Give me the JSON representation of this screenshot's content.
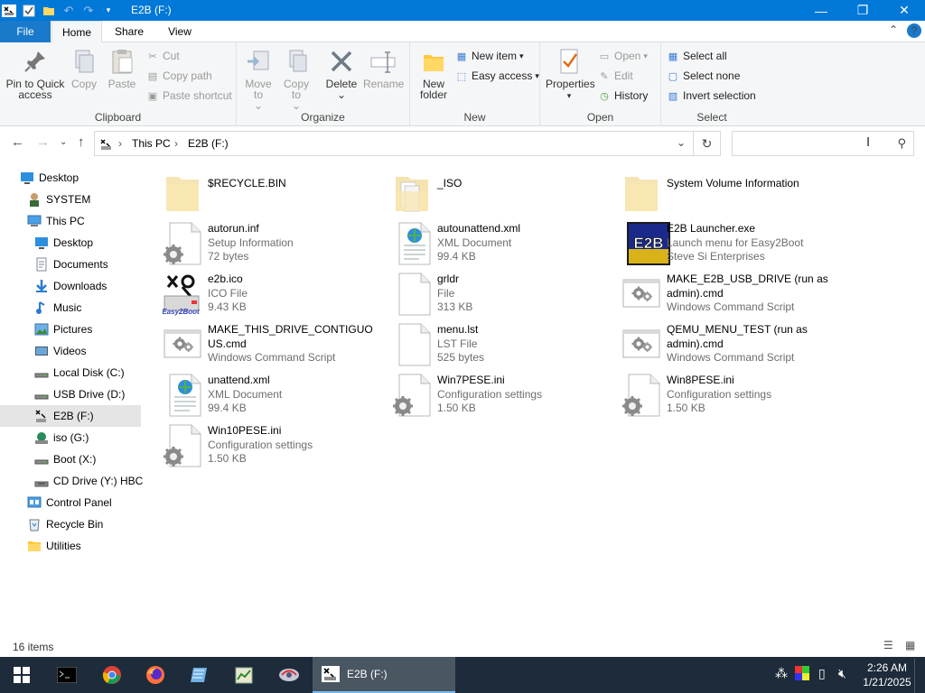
{
  "window": {
    "title": "E2B (F:)",
    "minimize_glyph": "—",
    "maximize_glyph": "❐",
    "close_glyph": "✕"
  },
  "ribbon_tabs": {
    "file": "File",
    "home": "Home",
    "share": "Share",
    "view": "View",
    "help": "?"
  },
  "clipboard": {
    "label": "Clipboard",
    "pin": "Pin to Quick access",
    "copy": "Copy",
    "paste": "Paste",
    "cut": "Cut",
    "copy_path": "Copy path",
    "paste_shortcut": "Paste shortcut"
  },
  "organize": {
    "label": "Organize",
    "move_to": "Move to",
    "copy_to": "Copy to",
    "delete": "Delete",
    "rename": "Rename"
  },
  "new_group": {
    "label": "New",
    "new_folder": "New folder",
    "new_item": "New item",
    "easy_access": "Easy access"
  },
  "open_group": {
    "label": "Open",
    "properties": "Properties",
    "open": "Open",
    "edit": "Edit",
    "history": "History"
  },
  "select_group": {
    "label": "Select",
    "select_all": "Select all",
    "select_none": "Select none",
    "invert": "Invert selection"
  },
  "address": {
    "crumbs": [
      "This PC",
      "E2B (F:)"
    ],
    "search_placeholder": ""
  },
  "nav_pane": [
    {
      "label": "Desktop",
      "icon": "desktop-icon",
      "level": 0
    },
    {
      "label": "SYSTEM",
      "icon": "user-icon",
      "level": 1
    },
    {
      "label": "This PC",
      "icon": "pc-icon",
      "level": 1
    },
    {
      "label": "Desktop",
      "icon": "desktop-icon",
      "level": 2
    },
    {
      "label": "Documents",
      "icon": "documents-icon",
      "level": 2
    },
    {
      "label": "Downloads",
      "icon": "downloads-icon",
      "level": 2
    },
    {
      "label": "Music",
      "icon": "music-icon",
      "level": 2
    },
    {
      "label": "Pictures",
      "icon": "pictures-icon",
      "level": 2
    },
    {
      "label": "Videos",
      "icon": "videos-icon",
      "level": 2
    },
    {
      "label": "Local Disk (C:)",
      "icon": "drive-icon",
      "level": 2
    },
    {
      "label": "USB Drive (D:)",
      "icon": "drive-icon",
      "level": 2
    },
    {
      "label": "E2B (F:)",
      "icon": "e2b-drive-icon",
      "level": 2,
      "selected": true
    },
    {
      "label": "iso (G:)",
      "icon": "iso-drive-icon",
      "level": 2
    },
    {
      "label": "Boot (X:)",
      "icon": "drive-icon",
      "level": 2
    },
    {
      "label": "CD Drive (Y:) HBC",
      "icon": "cd-drive-icon",
      "level": 2
    },
    {
      "label": "Control Panel",
      "icon": "control-panel-icon",
      "level": 1
    },
    {
      "label": "Recycle Bin",
      "icon": "recycle-bin-icon",
      "level": 1
    },
    {
      "label": "Utilities",
      "icon": "folder-icon",
      "level": 1
    }
  ],
  "files": [
    {
      "name": "$RECYCLE.BIN",
      "line2": "",
      "line3": "",
      "icon": "folder-hidden"
    },
    {
      "name": "_ISO",
      "line2": "",
      "line3": "",
      "icon": "folder-docs"
    },
    {
      "name": "System Volume Information",
      "line2": "",
      "line3": "",
      "icon": "folder-hidden"
    },
    {
      "name": "autorun.inf",
      "line2": "Setup Information",
      "line3": "72 bytes",
      "icon": "settings-file"
    },
    {
      "name": "autounattend.xml",
      "line2": "XML Document",
      "line3": "99.4 KB",
      "icon": "xml-file"
    },
    {
      "name": "E2B Launcher.exe",
      "line2": "Launch menu for Easy2Boot",
      "line3": "Steve Si Enterprises",
      "icon": "e2b-logo"
    },
    {
      "name": "e2b.ico",
      "line2": "ICO File",
      "line3": "9.43 KB",
      "icon": "e2b-ico"
    },
    {
      "name": "grldr",
      "line2": "File",
      "line3": "313 KB",
      "icon": "blank-file"
    },
    {
      "name": "MAKE_E2B_USB_DRIVE (run as admin).cmd",
      "line2": "Windows Command Script",
      "line3": "",
      "icon": "cmd-file"
    },
    {
      "name": "MAKE_THIS_DRIVE_CONTIGUOUS.cmd",
      "line2": "Windows Command Script",
      "line3": "",
      "icon": "cmd-file"
    },
    {
      "name": "menu.lst",
      "line2": "LST File",
      "line3": "525 bytes",
      "icon": "blank-file"
    },
    {
      "name": "QEMU_MENU_TEST (run as admin).cmd",
      "line2": "Windows Command Script",
      "line3": "",
      "icon": "cmd-file"
    },
    {
      "name": "unattend.xml",
      "line2": "XML Document",
      "line3": "99.4 KB",
      "icon": "xml-file"
    },
    {
      "name": "Win7PESE.ini",
      "line2": "Configuration settings",
      "line3": "1.50 KB",
      "icon": "settings-file"
    },
    {
      "name": "Win8PESE.ini",
      "line2": "Configuration settings",
      "line3": "1.50 KB",
      "icon": "settings-file"
    },
    {
      "name": "Win10PESE.ini",
      "line2": "Configuration settings",
      "line3": "1.50 KB",
      "icon": "settings-file"
    }
  ],
  "status": {
    "items": "16 items"
  },
  "taskbar": {
    "active_window": "E2B (F:)",
    "time": "2:26 AM",
    "date": "1/21/2025",
    "pinned": [
      "start-icon",
      "terminal-icon",
      "chrome-icon",
      "firefox-icon",
      "notepad-icon",
      "task-icon",
      "hbc-icon"
    ]
  },
  "colors": {
    "titlebar": "#0078d7",
    "file_tab": "#1979ca",
    "taskbar": "#1d2b3a",
    "selection": "#e5e5e5"
  }
}
